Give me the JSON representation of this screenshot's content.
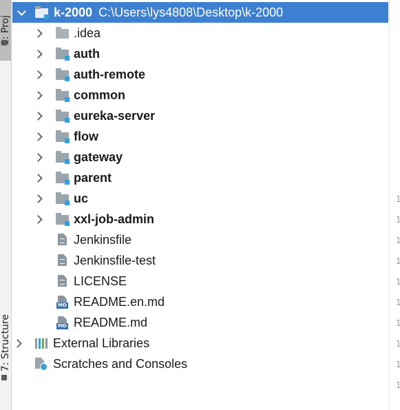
{
  "tool_window_tabs": {
    "project": "1: Proj",
    "structure": "7: Structure"
  },
  "project_tree": {
    "root": {
      "name": "k-2000",
      "path": "C:\\Users\\lys4808\\Desktop\\k-2000",
      "icon": "module-folder-icon",
      "expanded": true,
      "selected": true
    },
    "children": [
      {
        "name": ".idea",
        "type": "folder",
        "icon": "folder-icon",
        "bold": false
      },
      {
        "name": "auth",
        "type": "module",
        "icon": "module-folder-icon",
        "bold": true
      },
      {
        "name": "auth-remote",
        "type": "module",
        "icon": "module-folder-icon",
        "bold": true
      },
      {
        "name": "common",
        "type": "module",
        "icon": "module-folder-icon",
        "bold": true
      },
      {
        "name": "eureka-server",
        "type": "module",
        "icon": "module-folder-icon",
        "bold": true
      },
      {
        "name": "flow",
        "type": "module",
        "icon": "module-folder-icon",
        "bold": true
      },
      {
        "name": "gateway",
        "type": "module",
        "icon": "module-folder-icon",
        "bold": true
      },
      {
        "name": "parent",
        "type": "module",
        "icon": "module-folder-icon",
        "bold": true
      },
      {
        "name": "uc",
        "type": "module",
        "icon": "module-folder-icon",
        "bold": true
      },
      {
        "name": "xxl-job-admin",
        "type": "module",
        "icon": "module-folder-icon",
        "bold": true
      },
      {
        "name": "Jenkinsfile",
        "type": "file",
        "icon": "text-file-icon",
        "bold": false
      },
      {
        "name": "Jenkinsfile-test",
        "type": "file",
        "icon": "text-file-icon",
        "bold": false
      },
      {
        "name": "LICENSE",
        "type": "file",
        "icon": "text-file-icon",
        "bold": false
      },
      {
        "name": "README.en.md",
        "type": "markdown",
        "icon": "markdown-file-icon",
        "bold": false
      },
      {
        "name": "README.md",
        "type": "markdown",
        "icon": "markdown-file-icon",
        "bold": false
      }
    ],
    "external_libraries": {
      "name": "External Libraries",
      "icon": "libraries-icon"
    },
    "scratches": {
      "name": "Scratches and Consoles",
      "icon": "scratches-icon"
    }
  },
  "md_badge_text": "MD",
  "gutter_numbers": [
    "1",
    "1",
    "1",
    "1",
    "1",
    "1",
    "1",
    "1",
    "1",
    "1"
  ],
  "colors": {
    "selection": "#3d7fd0",
    "module_badge": "#389fd6",
    "folder": "#9aa5ae",
    "gutter_text": "#999999"
  }
}
